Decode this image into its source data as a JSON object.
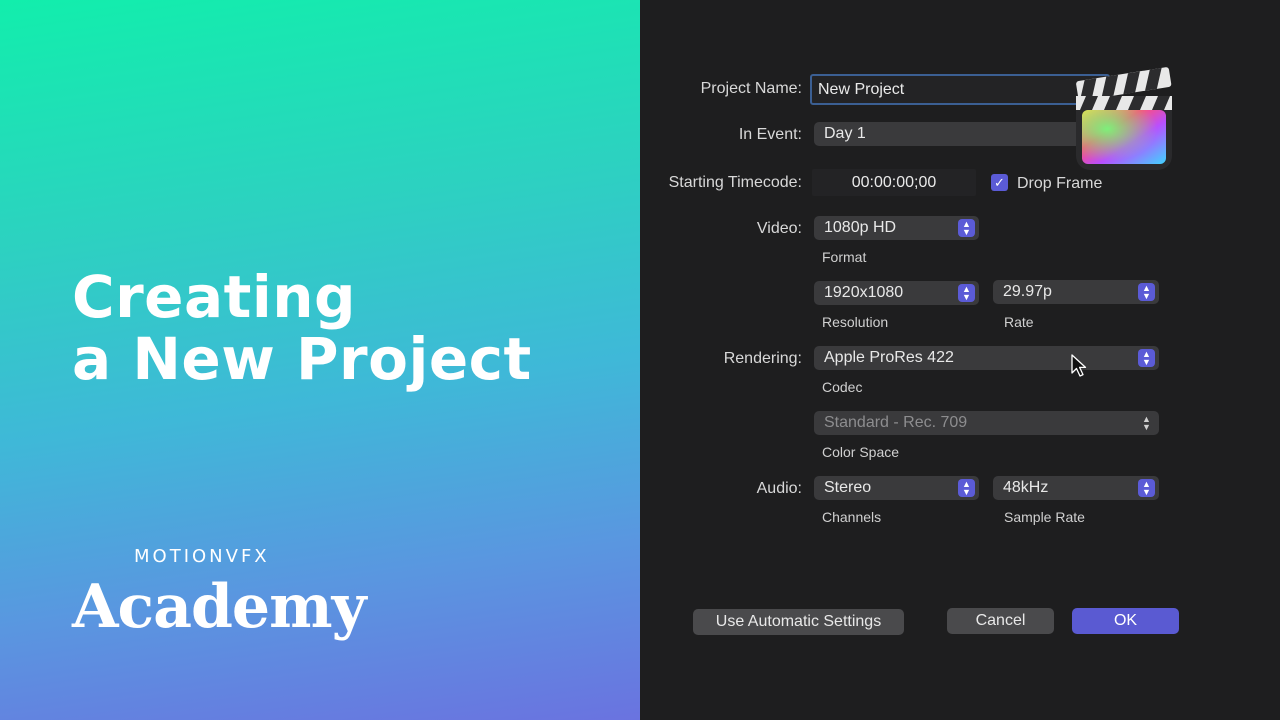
{
  "promo": {
    "title_line1": "Creating",
    "title_line2": "a New Project",
    "brand": "MOTIONVFX",
    "academy": "Academy"
  },
  "dialog": {
    "project_name_label": "Project Name:",
    "project_name_value": "New Project",
    "in_event_label": "In Event:",
    "in_event_value": "Day 1",
    "starting_timecode_label": "Starting Timecode:",
    "starting_timecode_value": "00:00:00;00",
    "drop_frame_label": "Drop Frame",
    "drop_frame_checked": true,
    "video_label": "Video:",
    "format_value": "1080p HD",
    "format_caption": "Format",
    "resolution_value": "1920x1080",
    "resolution_caption": "Resolution",
    "rate_value": "29.97p",
    "rate_caption": "Rate",
    "rendering_label": "Rendering:",
    "codec_value": "Apple ProRes 422",
    "codec_caption": "Codec",
    "color_space_value": "Standard - Rec. 709",
    "color_space_caption": "Color Space",
    "audio_label": "Audio:",
    "channels_value": "Stereo",
    "channels_caption": "Channels",
    "sample_rate_value": "48kHz",
    "sample_rate_caption": "Sample Rate",
    "auto_settings_button": "Use Automatic Settings",
    "cancel_button": "Cancel",
    "ok_button": "OK"
  },
  "icons": {
    "app_logo": "final-cut-pro-icon",
    "cursor": "mouse-pointer-icon",
    "stepper": "up-down-chevron-icon"
  },
  "colors": {
    "accent": "#5b5bd6",
    "dialog_bg": "#1e1e1f",
    "gradient_top": "#12eeac",
    "gradient_bottom": "#6a73e0"
  }
}
